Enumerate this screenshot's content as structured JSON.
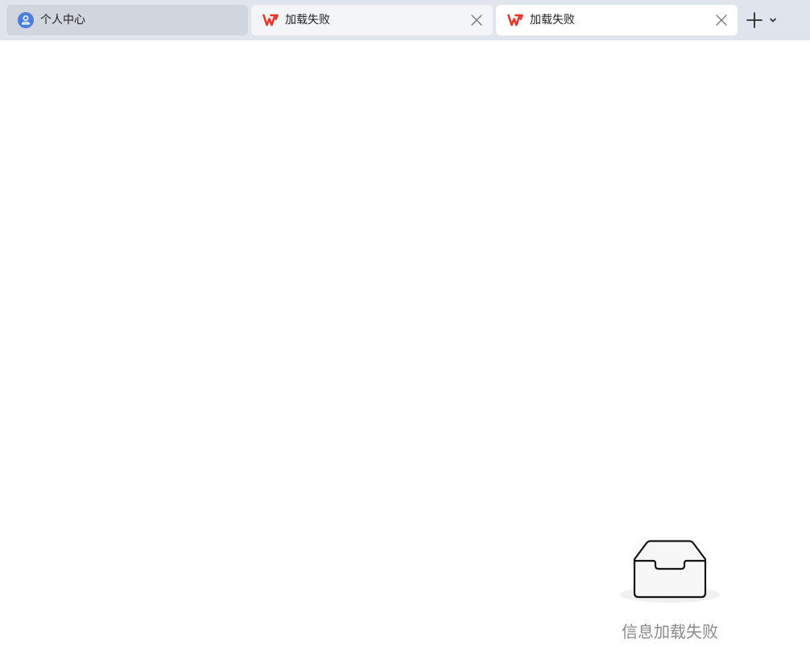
{
  "tabs": [
    {
      "label": "个人中心",
      "icon": "user-icon",
      "active": false,
      "closable": false
    },
    {
      "label": "加载失败",
      "icon": "wps-logo-icon",
      "active": false,
      "closable": true
    },
    {
      "label": "加载失败",
      "icon": "wps-logo-icon",
      "active": true,
      "closable": true
    }
  ],
  "tabbar": {
    "new_tab_icon": "plus-icon",
    "dropdown_icon": "chevron-down-icon"
  },
  "empty_state": {
    "icon": "empty-inbox-icon",
    "message": "信息加载失败"
  },
  "colors": {
    "tabbar_bg": "#e0e4ec",
    "user_icon_blue": "#4a7fe0",
    "wps_red": "#e8362b",
    "empty_text": "#8a8a8a"
  }
}
